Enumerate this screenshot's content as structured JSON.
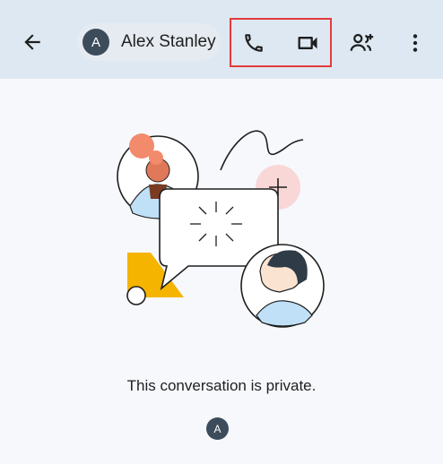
{
  "header": {
    "back_icon": "arrow-left-icon",
    "contact": {
      "avatar_initial": "A",
      "name": "Alex Stanley"
    },
    "actions": [
      {
        "name": "voice-call",
        "icon": "phone-icon"
      },
      {
        "name": "video-call",
        "icon": "video-camera-icon"
      },
      {
        "name": "add-people",
        "icon": "add-person-icon"
      },
      {
        "name": "more-options",
        "icon": "more-vert-icon"
      }
    ],
    "highlight_color": "#e43b3b"
  },
  "main": {
    "message": "This conversation is private.",
    "avatar_initial": "A"
  },
  "colors": {
    "appbar_bg": "#dde8f2",
    "page_bg": "#f6f8fc",
    "avatar_bg": "#3d4c5b",
    "illustration_accent_yellow": "#f4b400",
    "illustration_accent_pink": "#f9d7d7",
    "illustration_accent_orange": "#f28b6b"
  }
}
